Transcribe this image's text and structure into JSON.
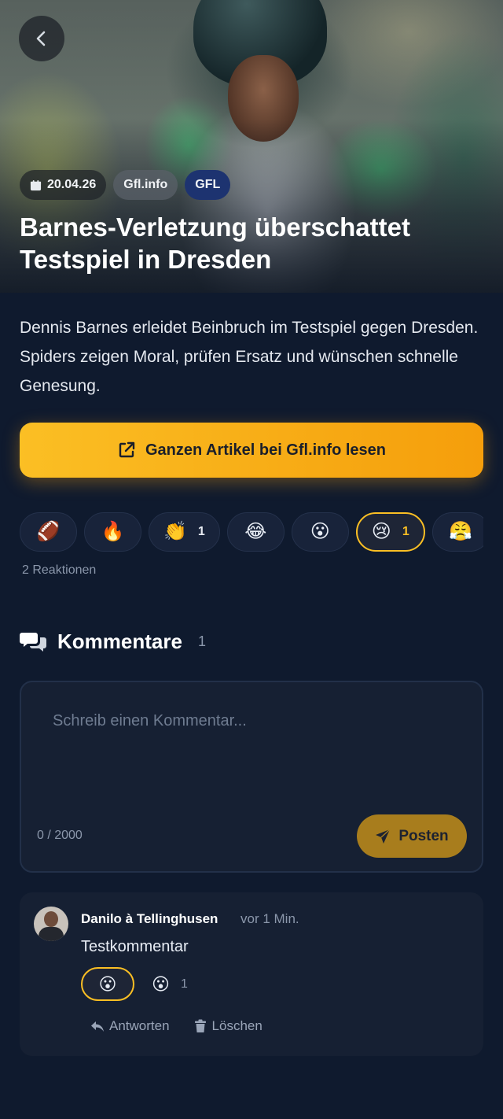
{
  "hero": {
    "date": "20.04.26",
    "source": "Gfl.info",
    "league": "GFL",
    "title": "Barnes-Verletzung überschattet Testspiel in Dresden"
  },
  "article": {
    "summary": "Dennis Barnes erleidet Beinbruch im Testspiel gegen Dresden. Spiders zeigen Moral, prüfen Ersatz und wünschen schnelle Genesung.",
    "read_button": "Ganzen Artikel bei Gfl.info lesen"
  },
  "reactions": {
    "items": [
      {
        "emoji": "🏈",
        "count": ""
      },
      {
        "emoji": "🔥",
        "count": ""
      },
      {
        "emoji": "👏",
        "count": "1"
      },
      {
        "emoji": "😂",
        "count": ""
      },
      {
        "emoji": "😮",
        "count": ""
      },
      {
        "emoji": "😢",
        "count": "1"
      },
      {
        "emoji": "😤",
        "count": ""
      }
    ],
    "total_label": "2 Reaktionen"
  },
  "comments": {
    "title": "Kommentare",
    "count": "1",
    "input_placeholder": "Schreib einen Kommentar...",
    "char_count": "0 / 2000",
    "post_button": "Posten",
    "list": [
      {
        "author": "Danilo à Tellinghusen",
        "time": "vor 1 Min.",
        "text": "Testkommentar",
        "active_reaction": "😮",
        "reaction_emoji": "😮",
        "reaction_count": "1",
        "reply_label": "Antworten",
        "delete_label": "Löschen"
      }
    ]
  },
  "colors": {
    "accent": "#fbbf24",
    "background": "#0f1a2e",
    "card": "#162033",
    "league_chip": "#1d3370"
  }
}
